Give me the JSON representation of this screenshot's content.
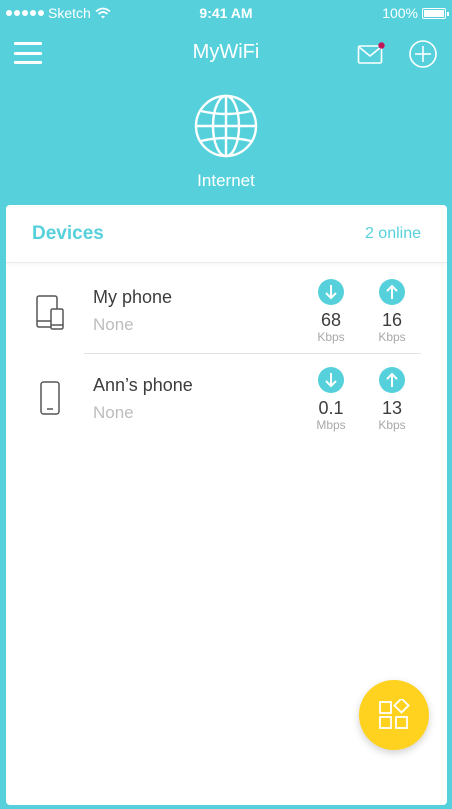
{
  "status_bar": {
    "carrier": "Sketch",
    "time": "9:41 AM",
    "battery": "100%"
  },
  "nav": {
    "title": "MyWiFi",
    "icons": {
      "menu": "hamburger-menu-icon",
      "mail": "mail-icon",
      "add": "plus-circle-icon"
    },
    "mail_badge_color": "#C2185B"
  },
  "internet": {
    "label": "Internet",
    "icon": "globe-icon"
  },
  "devices": {
    "title": "Devices",
    "online": "2 online",
    "items": [
      {
        "name": "My phone",
        "subtitle": "None",
        "icon": "tablet-phone-icon",
        "download": {
          "value": "68",
          "unit": "Kbps"
        },
        "upload": {
          "value": "16",
          "unit": "Kbps"
        }
      },
      {
        "name": "Ann’s phone",
        "subtitle": "None",
        "icon": "phone-icon",
        "download": {
          "value": "0.1",
          "unit": "Mbps"
        },
        "upload": {
          "value": "13",
          "unit": "Kbps"
        }
      }
    ]
  },
  "fab": {
    "icon": "apps-grid-icon"
  },
  "colors": {
    "background": "#56D1DC",
    "accent": "#56D1DC",
    "fab": "#FFD21F",
    "panel": "#FFFFFF"
  }
}
